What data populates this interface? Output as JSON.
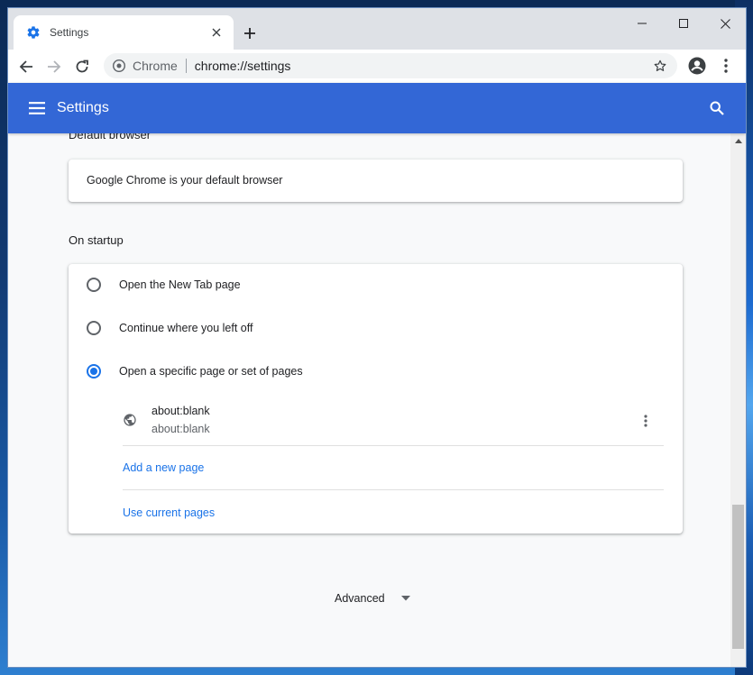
{
  "browser": {
    "tab": {
      "title": "Settings"
    },
    "omnibox": {
      "chip": "Chrome",
      "url": "chrome://settings"
    }
  },
  "header": {
    "title": "Settings"
  },
  "default_browser": {
    "section_label": "Default browser",
    "status": "Google Chrome is your default browser"
  },
  "startup": {
    "section_label": "On startup",
    "options": [
      {
        "label": "Open the New Tab page",
        "checked": false
      },
      {
        "label": "Continue where you left off",
        "checked": false
      },
      {
        "label": "Open a specific page or set of pages",
        "checked": true
      }
    ],
    "pages": [
      {
        "title": "about:blank",
        "url": "about:blank"
      }
    ],
    "add_page_label": "Add a new page",
    "use_current_label": "Use current pages"
  },
  "advanced": {
    "label": "Advanced"
  },
  "colors": {
    "header_blue": "#3367d6",
    "link_blue": "#1a73e8"
  },
  "icons": {
    "tab_favicon": "gear-icon",
    "back": "arrow-left-icon",
    "forward": "arrow-right-icon",
    "reload": "reload-icon",
    "star": "star-icon",
    "profile": "account-icon",
    "menu": "more-vert-icon",
    "hamburger": "menu-icon",
    "search": "search-icon",
    "globe": "globe-icon",
    "expand": "caret-down-icon"
  }
}
